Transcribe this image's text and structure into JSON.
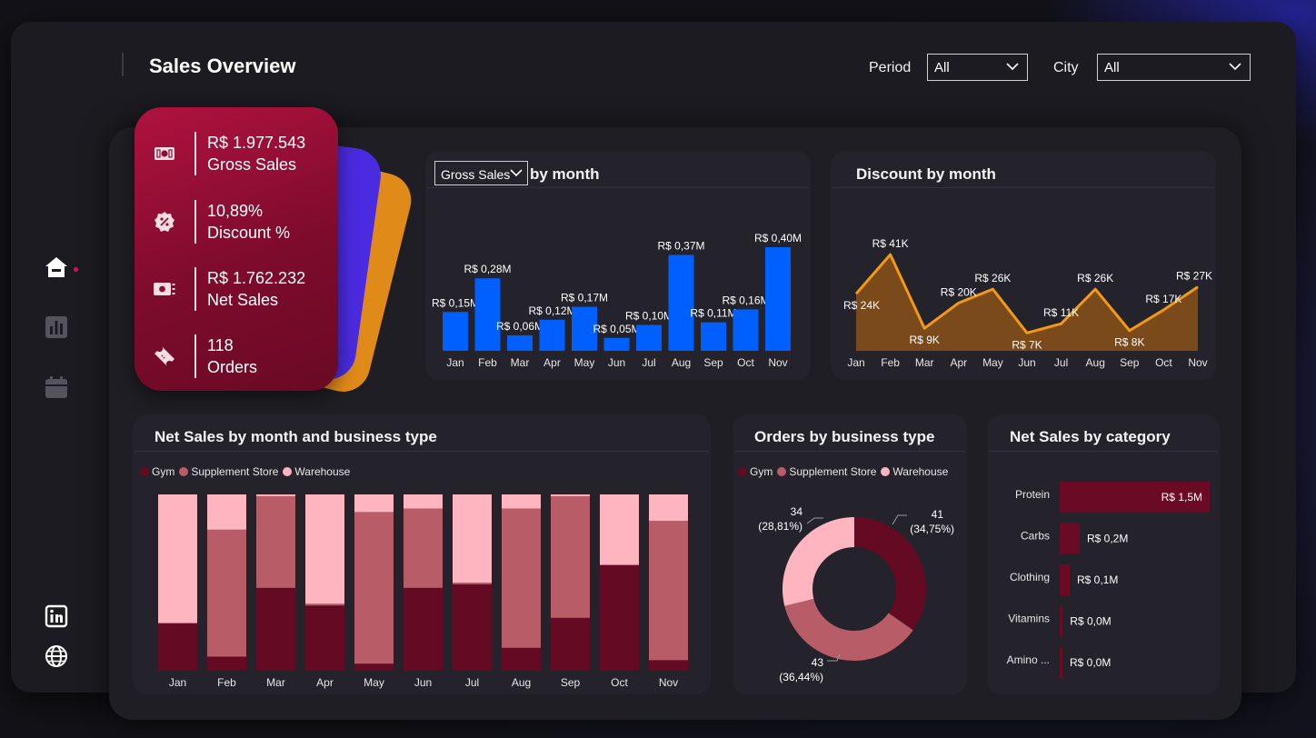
{
  "header": {
    "title": "Sales Overview",
    "period_label": "Period",
    "period_value": "All",
    "city_label": "City",
    "city_value": "All"
  },
  "sidebar": {
    "items": [
      {
        "name": "home",
        "icon": "home-icon",
        "active": true
      },
      {
        "name": "charts",
        "icon": "bar-chart-icon",
        "active": false
      },
      {
        "name": "calendar",
        "icon": "calendar-icon",
        "active": false
      }
    ],
    "links": [
      {
        "name": "linkedin",
        "icon": "linkedin-icon"
      },
      {
        "name": "website",
        "icon": "globe-icon"
      }
    ]
  },
  "kpis": [
    {
      "value": "R$ 1.977.543",
      "label": "Gross Sales",
      "icon": "money-bill-icon"
    },
    {
      "value": "10,89%",
      "label": "Discount %",
      "icon": "discount-badge-icon"
    },
    {
      "value": "R$ 1.762.232",
      "label": "Net Sales",
      "icon": "cash-icon"
    },
    {
      "value": "118",
      "label": "Orders",
      "icon": "ticket-icon"
    }
  ],
  "colors": {
    "accent": "#d4145a",
    "kpi_card": "#8e0e33",
    "gross_bar": "#0060ff",
    "discount_line": "#f39a14",
    "discount_area": "#7b4a1b",
    "gym": "#640a22",
    "supplement_store": "#b85c68",
    "warehouse": "#ffb5c0",
    "category_bar": "#6b0a24"
  },
  "chart_data": [
    {
      "type": "bar",
      "id": "gross_by_month",
      "measure_selector": "Gross Sales",
      "title": "by month",
      "categories": [
        "Jan",
        "Feb",
        "Mar",
        "Apr",
        "May",
        "Jun",
        "Jul",
        "Aug",
        "Sep",
        "Oct",
        "Nov"
      ],
      "values": [
        0.15,
        0.28,
        0.06,
        0.12,
        0.17,
        0.05,
        0.1,
        0.37,
        0.11,
        0.16,
        0.4
      ],
      "labels": [
        "R$ 0,15M",
        "R$ 0,28M",
        "R$ 0,06M",
        "R$ 0,12M",
        "R$ 0,17M",
        "R$ 0,05M",
        "R$ 0,10M",
        "R$ 0,37M",
        "R$ 0,11M",
        "R$ 0,16M",
        "R$ 0,40M"
      ],
      "unit": "R$ M",
      "ylim": [
        0,
        0.42
      ],
      "grid": false
    },
    {
      "type": "area",
      "id": "discount_by_month",
      "title": "Discount by month",
      "categories": [
        "Jan",
        "Feb",
        "Mar",
        "Apr",
        "May",
        "Jun",
        "Jul",
        "Aug",
        "Sep",
        "Oct",
        "Nov"
      ],
      "values": [
        24,
        41,
        9,
        20,
        26,
        7,
        11,
        26,
        8,
        17,
        27
      ],
      "labels": [
        "R$ 24K",
        "R$ 41K",
        "R$ 9K",
        "R$ 20K",
        "R$ 26K",
        "R$ 7K",
        "R$ 11K",
        "R$ 26K",
        "R$ 8K",
        "R$ 17K",
        "R$ 27K"
      ],
      "unit": "R$ K",
      "ylim": [
        0,
        45
      ],
      "grid": false
    },
    {
      "type": "bar",
      "stacked": "100%",
      "id": "net_sales_by_month_business_type",
      "title": "Net Sales by month and business type",
      "categories": [
        "Jan",
        "Feb",
        "Mar",
        "Apr",
        "May",
        "Jun",
        "Jul",
        "Aug",
        "Sep",
        "Oct",
        "Nov"
      ],
      "legend": "top-left",
      "series": [
        {
          "name": "Gym",
          "values": [
            27,
            8,
            47,
            37,
            4,
            47,
            49,
            13,
            30,
            60,
            6
          ]
        },
        {
          "name": "Supplement Store",
          "values": [
            0,
            72,
            52,
            1,
            86,
            45,
            1,
            79,
            69,
            0,
            79
          ]
        },
        {
          "name": "Warehouse",
          "values": [
            73,
            20,
            1,
            62,
            10,
            8,
            50,
            8,
            1,
            40,
            15
          ]
        }
      ],
      "ylim": [
        0,
        100
      ]
    },
    {
      "type": "pie",
      "donut": true,
      "id": "orders_by_business_type",
      "title": "Orders by business type",
      "legend": "top-left",
      "legend_items": [
        "Gym",
        "Supplement Store",
        "Warehouse"
      ],
      "slices": [
        {
          "name": "Gym",
          "value": 41,
          "label": "41",
          "percent_label": "(34,75%)"
        },
        {
          "name": "Supplement Store",
          "value": 43,
          "label": "43",
          "percent_label": "(36,44%)"
        },
        {
          "name": "Warehouse",
          "value": 34,
          "label": "34",
          "percent_label": "(28,81%)"
        }
      ]
    },
    {
      "type": "bar",
      "orientation": "horizontal",
      "id": "net_sales_by_category",
      "title": "Net Sales by category",
      "categories": [
        "Protein",
        "Carbs",
        "Clothing",
        "Vitamins",
        "Amino ..."
      ],
      "values": [
        1.5,
        0.2,
        0.1,
        0.03,
        0.02
      ],
      "labels": [
        "R$ 1,5M",
        "R$ 0,2M",
        "R$ 0,1M",
        "R$ 0,0M",
        "R$ 0,0M"
      ],
      "unit": "R$ M",
      "xlim": [
        0,
        1.5
      ]
    }
  ]
}
